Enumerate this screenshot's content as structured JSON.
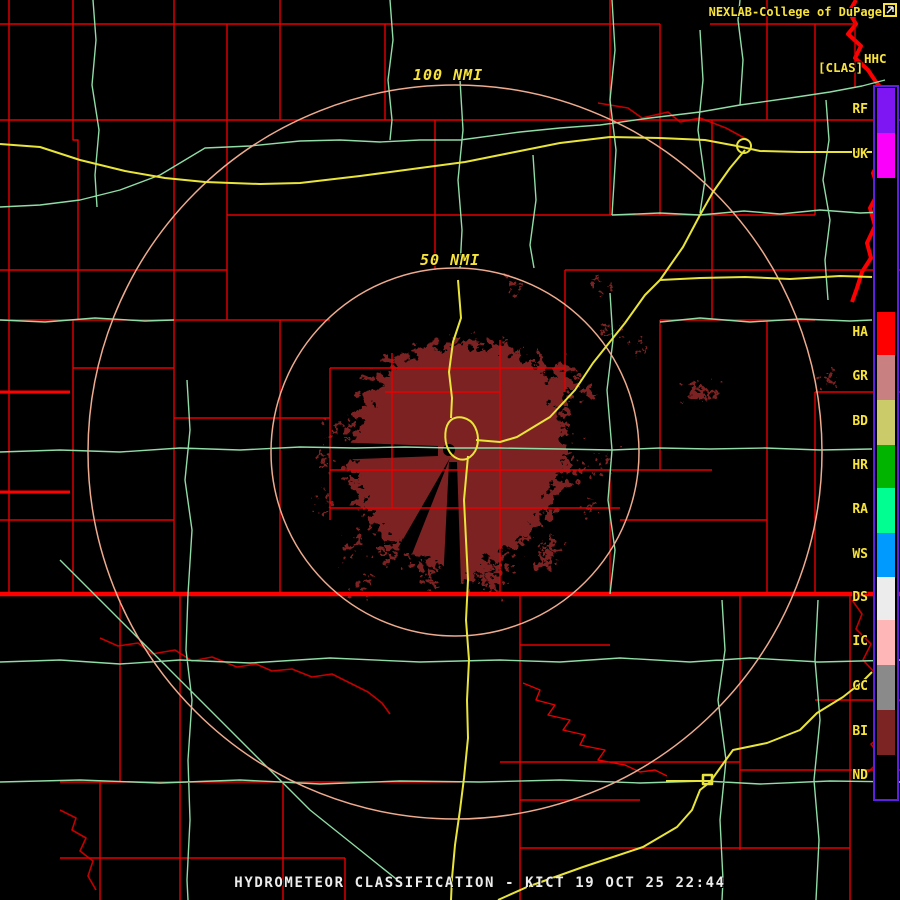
{
  "header": {
    "brand": "NEXLAB-College of DuPage",
    "product_abbr": "HHC",
    "product_tag": "[CLAS]"
  },
  "map": {
    "ring_labels": {
      "outer": "100 NMI",
      "inner": "50 NMI"
    },
    "ring_radii_nmi": [
      100,
      50
    ],
    "radar_site": "KICT"
  },
  "legend": {
    "categories": [
      {
        "code": "RF",
        "color": "#7d16f2"
      },
      {
        "code": "UK",
        "color": "#fb00fb"
      },
      {
        "code": "HA",
        "color": "#ff0000"
      },
      {
        "code": "GR",
        "color": "#c98080"
      },
      {
        "code": "BD",
        "color": "#cbcb6a"
      },
      {
        "code": "HR",
        "color": "#00b400"
      },
      {
        "code": "RA",
        "color": "#00ff90"
      },
      {
        "code": "WS",
        "color": "#009aff"
      },
      {
        "code": "DS",
        "color": "#ececec"
      },
      {
        "code": "IC",
        "color": "#ffb6b6"
      },
      {
        "code": "GC",
        "color": "#8a8a8a"
      },
      {
        "code": "BI",
        "color": "#7c2424"
      },
      {
        "code": "ND",
        "color": "#000000"
      }
    ]
  },
  "footer": {
    "title": "HYDROMETEOR CLASSIFICATION - KICT 19 OCT 25 22:44"
  },
  "colors": {
    "background": "#000000",
    "county": "#e60000",
    "state_line": "#ff0000",
    "river": "#c40000",
    "river_major": "#ff0000",
    "road_green": "#8fdca6",
    "highway_yellow": "#e8e43a",
    "range_ring": "#eeab8e",
    "echo_biological": "#7b2321",
    "text_yellow": "#f7e33c",
    "text_white": "#ececec",
    "legend_border": "#5f1fe0"
  }
}
